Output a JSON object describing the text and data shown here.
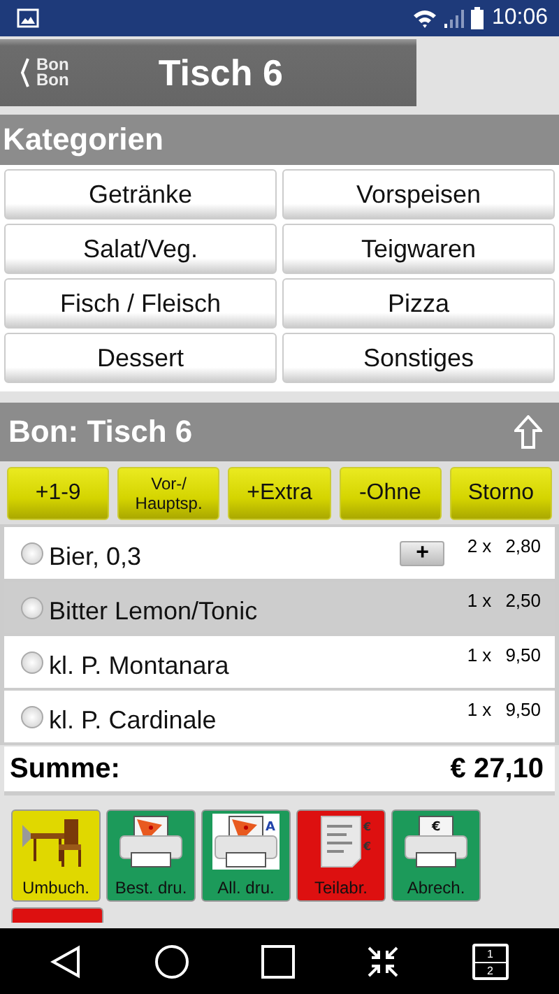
{
  "status_bar": {
    "time": "10:06"
  },
  "header": {
    "logo": [
      "Bon",
      "Bon"
    ],
    "title": "Tisch 6"
  },
  "categories": {
    "heading": "Kategorien",
    "items": [
      {
        "label": "Getränke"
      },
      {
        "label": "Vorspeisen"
      },
      {
        "label": "Salat/Veg."
      },
      {
        "label": "Teigwaren"
      },
      {
        "label": "Fisch / Fleisch"
      },
      {
        "label": "Pizza"
      },
      {
        "label": "Dessert"
      },
      {
        "label": "Sonstiges"
      }
    ]
  },
  "bon": {
    "heading": "Bon: Tisch 6",
    "actions": [
      {
        "label": "+1-9"
      },
      {
        "label": "Vor-/ Hauptsp."
      },
      {
        "label": "+Extra"
      },
      {
        "label": "-Ohne"
      },
      {
        "label": "Storno"
      }
    ],
    "items": [
      {
        "name": "Bier, 0,3",
        "qty": "2 x",
        "price": "2,80",
        "selected": false,
        "highlighted": false,
        "plus": "+"
      },
      {
        "name": "Bitter Lemon/Tonic",
        "qty": "1 x",
        "price": "2,50",
        "selected": false,
        "highlighted": true
      },
      {
        "name": "kl. P. Montanara",
        "qty": "1 x",
        "price": "9,50",
        "selected": false,
        "highlighted": false
      },
      {
        "name": "kl. P. Cardinale",
        "qty": "1 x",
        "price": "9,50",
        "selected": false,
        "highlighted": false
      }
    ],
    "sum_label": "Summe:",
    "sum": "€ 27,10"
  },
  "functions": [
    {
      "label": "Umbuch.",
      "color": "#e0d800",
      "kind": "furniture"
    },
    {
      "label": "Best. dru.",
      "color": "#1c9a5a",
      "kind": "print"
    },
    {
      "label": "All. dru.",
      "color": "#1c9a5a",
      "kind": "print_all",
      "mark": "A"
    },
    {
      "label": "Teilabr.",
      "color": "#dd1010",
      "kind": "receipt",
      "mark": "€"
    },
    {
      "label": "Abrech.",
      "color": "#1c9a5a",
      "kind": "print_euro",
      "mark": "€"
    }
  ],
  "functions_row2": [
    {
      "color": "#dd1010"
    }
  ],
  "nav_bar": {
    "split_icon_digits": [
      "1",
      "2"
    ]
  }
}
